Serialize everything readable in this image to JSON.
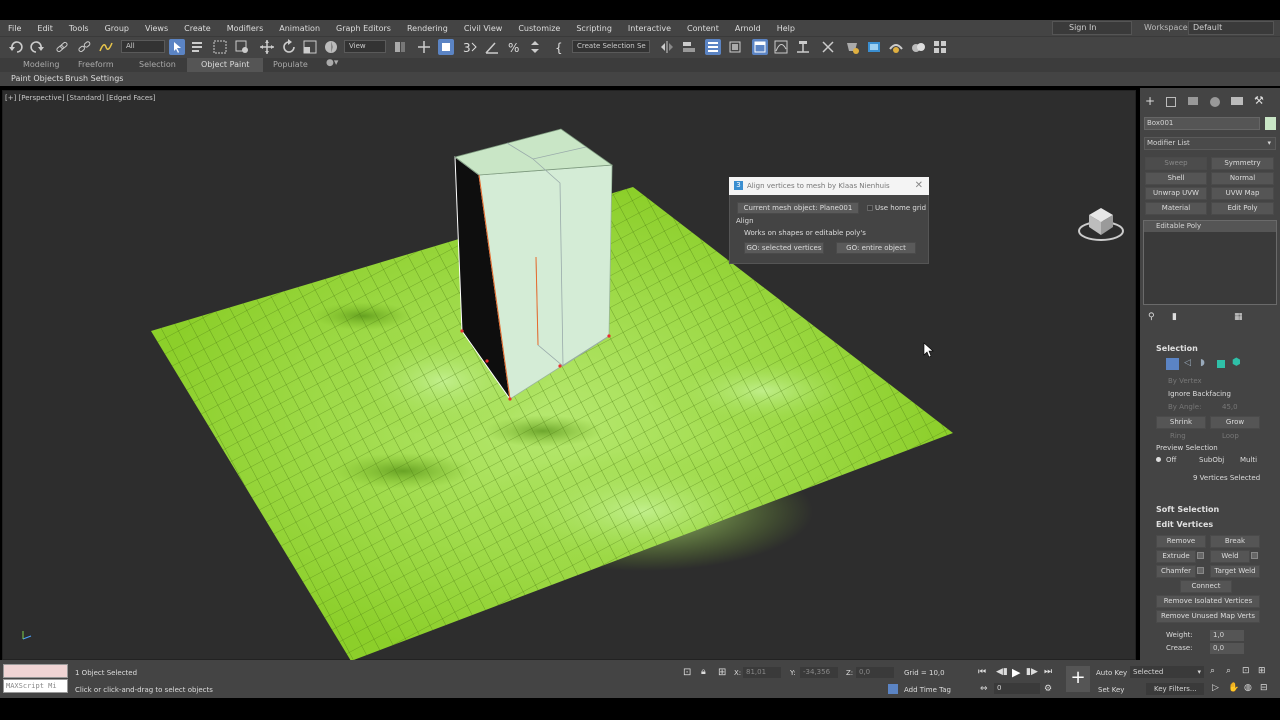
{
  "menu": [
    "File",
    "Edit",
    "Tools",
    "Group",
    "Views",
    "Create",
    "Modifiers",
    "Animation",
    "Graph Editors",
    "Rendering",
    "Civil View",
    "Customize",
    "Scripting",
    "Interactive",
    "Content",
    "Arnold",
    "Help"
  ],
  "signin": "Sign In",
  "workspaces_label": "Workspaces:",
  "workspaces_value": "Default",
  "toolbar": {
    "filter": "All",
    "view": "View",
    "create_selection": "Create Selection Se"
  },
  "ribbon_tabs": [
    "Modeling",
    "Freeform",
    "Selection",
    "Object Paint",
    "Populate"
  ],
  "subribbon": [
    "Paint Objects",
    "Brush Settings"
  ],
  "viewport_label": "[+] [Perspective] [Standard] [Edged Faces]",
  "dialog": {
    "title": "Align vertices to mesh by Klaas Nienhuis",
    "current_mesh": "Current mesh object: Plane001",
    "use_home_grid": "Use home grid",
    "align": "Align",
    "works_on": "Works on shapes or editable poly's",
    "go_selected": "GO: selected vertices",
    "go_entire": "GO: entire object"
  },
  "panel": {
    "object_name": "Box001",
    "modifier_list": "Modifier List",
    "mod_buttons": [
      "Sweep",
      "Symmetry",
      "Shell",
      "Normal",
      "Unwrap UVW",
      "UVW Map",
      "Material",
      "Edit Poly"
    ],
    "stack_item": "Editable Poly",
    "selection_title": "Selection",
    "by_vertex": "By Vertex",
    "ignore_backfacing": "Ignore Backfacing",
    "by_angle": "By Angle:",
    "by_angle_val": "45,0",
    "shrink": "Shrink",
    "grow": "Grow",
    "ring": "Ring",
    "loop": "Loop",
    "preview_selection": "Preview Selection",
    "off": "Off",
    "subobj": "SubObj",
    "multi": "Multi",
    "vertices_selected": "9 Vertices Selected",
    "soft_selection": "Soft Selection",
    "edit_vertices": "Edit Vertices",
    "remove": "Remove",
    "break": "Break",
    "extrude": "Extrude",
    "weld": "Weld",
    "chamfer": "Chamfer",
    "target_weld": "Target Weld",
    "connect": "Connect",
    "remove_isolated": "Remove Isolated Vertices",
    "remove_unused": "Remove Unused Map Verts",
    "weight_label": "Weight:",
    "weight_val": "1,0",
    "crease_label": "Crease:",
    "crease_val": "0,0"
  },
  "status": {
    "maxscript": "MAXScript Mi",
    "objects_selected": "1 Object Selected",
    "prompt": "Click or click-and-drag to select objects",
    "x_label": "X:",
    "x_val": "81,01",
    "y_label": "Y:",
    "y_val": "-34,356",
    "z_label": "Z:",
    "z_val": "0,0",
    "grid": "Grid = 10,0",
    "add_time_tag": "Add Time Tag",
    "frame": "0",
    "auto_key": "Auto Key",
    "set_key": "Set Key",
    "selected": "Selected",
    "key_filters": "Key Filters..."
  },
  "colors": {
    "ground": "#8ccf2a",
    "box": "#d4ecd6",
    "ui_bg": "#444444",
    "viewport": "#2d2d2d"
  }
}
